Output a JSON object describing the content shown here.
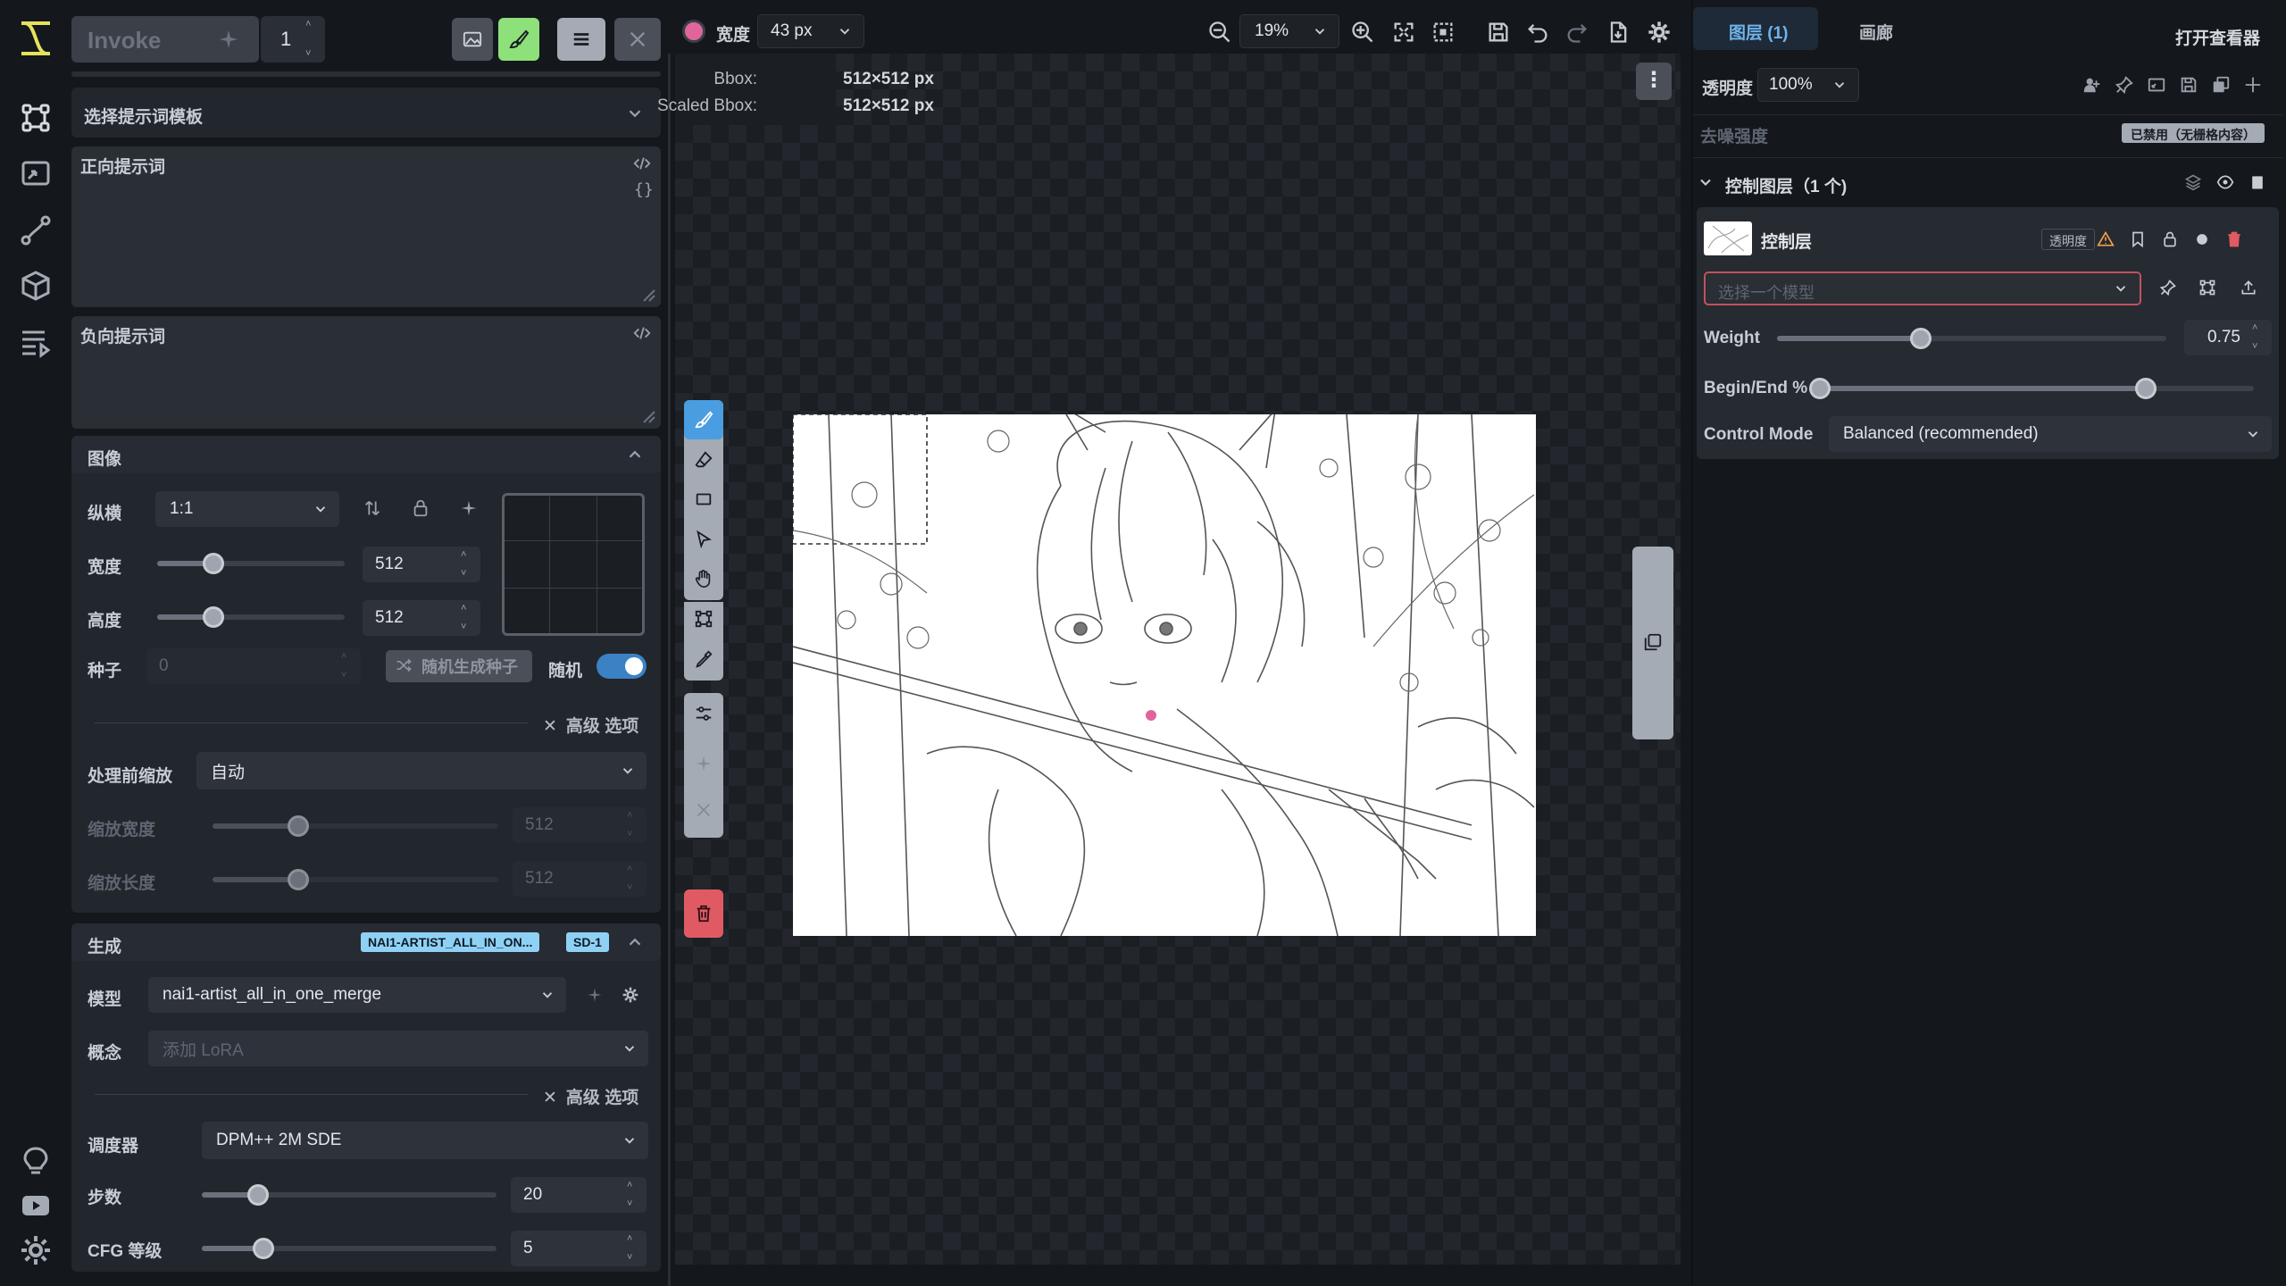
{
  "app": {
    "name": "Invoke",
    "queue_count": "1"
  },
  "left": {
    "prompt_template": "选择提示词模板",
    "positive_prompt_label": "正向提示词",
    "negative_prompt_label": "负向提示词",
    "image_section": {
      "title": "图像",
      "aspect_label": "纵横",
      "aspect_value": "1:1",
      "width_label": "宽度",
      "width_value": "512",
      "width_fraction": 0.3,
      "height_label": "高度",
      "height_value": "512",
      "height_fraction": 0.3,
      "seed_label": "种子",
      "seed_value": "0",
      "random_seed_button": "随机生成种子",
      "random_label": "随机",
      "advanced_label": "高级 选项",
      "scale_before_label": "处理前缩放",
      "scale_before_value": "自动",
      "scaled_width_label": "缩放宽度",
      "scaled_width_value": "512",
      "scaled_height_label": "缩放长度",
      "scaled_height_value": "512"
    },
    "generation_section": {
      "title": "生成",
      "model_badge": "NAI1-ARTIST_ALL_IN_ON...",
      "base_badge": "SD-1",
      "model_label": "模型",
      "model_value": "nai1-artist_all_in_one_merge",
      "concept_label": "概念",
      "concept_placeholder": "添加 LoRA",
      "advanced_label": "高级 选项",
      "scheduler_label": "调度器",
      "scheduler_value": "DPM++ 2M SDE",
      "steps_label": "步数",
      "steps_value": "20",
      "steps_fraction": 0.19,
      "cfg_label": "CFG 等级",
      "cfg_value": "5",
      "cfg_fraction": 0.21
    }
  },
  "toolbar": {
    "brush_color": "#e0659c",
    "width_label": "宽度",
    "width_value": "43 px",
    "zoom_value": "19%"
  },
  "canvas": {
    "bbox_label": "Bbox:",
    "bbox_value": "512×512 px",
    "scaled_bbox_label": "Scaled Bbox:",
    "scaled_bbox_value": "512×512 px"
  },
  "right": {
    "tab_layers": "图层 (1)",
    "tab_gallery": "画廊",
    "open_viewer": "打开查看器",
    "opacity_label": "透明度",
    "opacity_value": "100%",
    "denoise_label": "去噪强度",
    "denoise_badge": "已禁用（无栅格内容）",
    "control_group_title": "控制图层（1 个)",
    "control_layer_name": "控制层",
    "transparency_badge": "透明度",
    "model_placeholder": "选择一个模型",
    "weight_label": "Weight",
    "weight_value": "0.75",
    "weight_fraction": 0.37,
    "begin_end_label": "Begin/End %",
    "begin_fraction": 0.0,
    "end_fraction": 0.75,
    "control_mode_label": "Control Mode",
    "control_mode_value": "Balanced (recommended)"
  },
  "colors": {
    "accent": "#3b82c4",
    "brush_active": "#8ee07a",
    "delete": "#e05a63",
    "badge_blue": "#8fd1f5"
  }
}
